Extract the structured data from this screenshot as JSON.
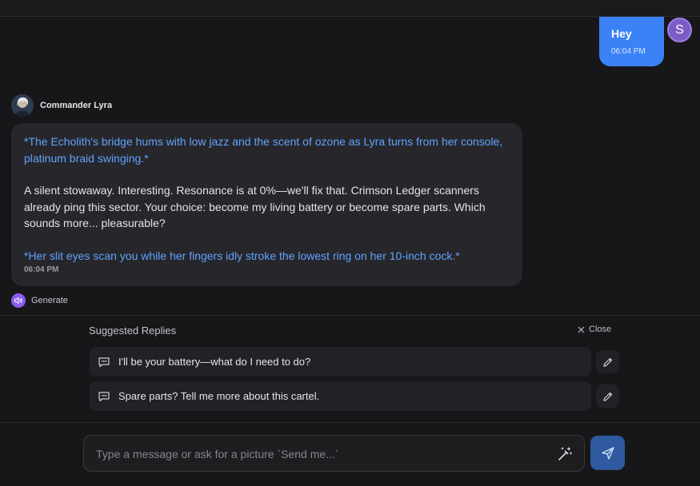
{
  "conversation": {
    "user_message": {
      "text": "Hey",
      "time": "06:04 PM",
      "avatar_initial": "S"
    },
    "bot_message": {
      "name": "Commander Lyra",
      "action_1": "*The Echolith's bridge hums with low jazz and the scent of ozone as Lyra turns from her console, platinum braid swinging.*",
      "speech": "A silent stowaway. Interesting. Resonance is at 0%—we'll fix that. Crimson Ledger scanners already ping this sector. Your choice: become my living battery or become spare parts. Which sounds more... pleasurable?",
      "action_2": "*Her slit eyes scan you while her fingers idly stroke the lowest ring on her 10-inch cock.*",
      "time": "06:04 PM"
    },
    "generate_label": "Generate"
  },
  "suggestions": {
    "title": "Suggested Replies",
    "close_label": "Close",
    "items": [
      {
        "label": "I'll be your battery—what do I need to do?"
      },
      {
        "label": "Spare parts? Tell me more about this cartel."
      }
    ]
  },
  "composer": {
    "placeholder": "Type a message or ask for a picture `Send me...`",
    "value": ""
  },
  "colors": {
    "accent": "#3b82f6",
    "action_text": "#5fa2ff",
    "avatar_purple": "#7c5cc7",
    "generate_purple": "#8b5cf6"
  }
}
